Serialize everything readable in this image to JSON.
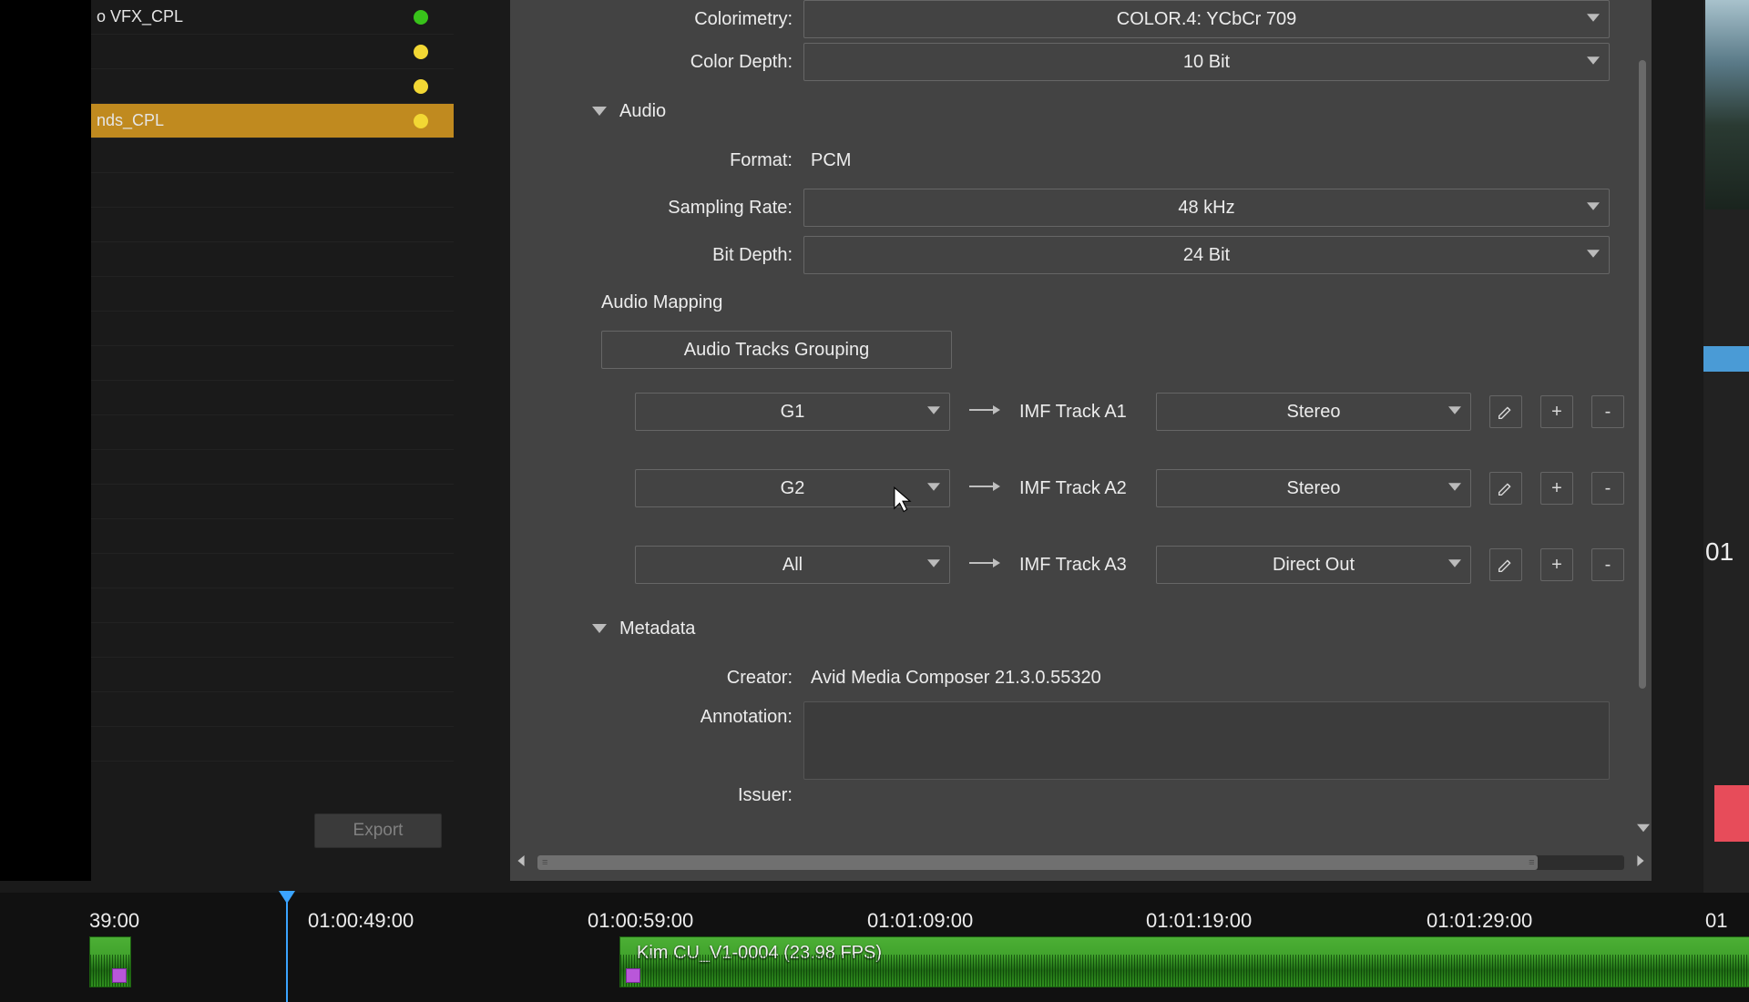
{
  "sidebar": {
    "items": [
      {
        "label": "o VFX_CPL",
        "dot": "green",
        "selected": false
      },
      {
        "label": "",
        "dot": "yellow",
        "selected": false
      },
      {
        "label": "",
        "dot": "yellow",
        "selected": false
      },
      {
        "label": "nds_CPL",
        "dot": "yellow",
        "selected": true
      }
    ],
    "export_label": "Export"
  },
  "settings": {
    "colorimetry": {
      "label": "Colorimetry:",
      "value": "COLOR.4: YCbCr 709"
    },
    "color_depth": {
      "label": "Color Depth:",
      "value": "10 Bit"
    },
    "audio_section": "Audio",
    "format": {
      "label": "Format:",
      "value": "PCM"
    },
    "sampling_rate": {
      "label": "Sampling Rate:",
      "value": "48 kHz"
    },
    "bit_depth": {
      "label": "Bit Depth:",
      "value": "24 Bit"
    },
    "audio_mapping_label": "Audio Mapping",
    "grouping_btn": "Audio Tracks Grouping",
    "tracks": [
      {
        "group": "G1",
        "track": "IMF Track A1",
        "mode": "Stereo"
      },
      {
        "group": "G2",
        "track": "IMF Track A2",
        "mode": "Stereo"
      },
      {
        "group": "All",
        "track": "IMF Track A3",
        "mode": "Direct Out"
      }
    ],
    "metadata_section": "Metadata",
    "creator": {
      "label": "Creator:",
      "value": "Avid Media Composer 21.3.0.55320"
    },
    "annotation": {
      "label": "Annotation:",
      "value": ""
    },
    "issuer": {
      "label": "Issuer:",
      "value": ""
    },
    "btn_plus": "+",
    "btn_minus": "-"
  },
  "right": {
    "tc": "01"
  },
  "timeline": {
    "ticks": [
      {
        "pos": 98,
        "label": "39:00"
      },
      {
        "pos": 338,
        "label": "01:00:49:00"
      },
      {
        "pos": 645,
        "label": "01:00:59:00"
      },
      {
        "pos": 952,
        "label": "01:01:09:00"
      },
      {
        "pos": 1258,
        "label": "01:01:19:00"
      },
      {
        "pos": 1566,
        "label": "01:01:29:00"
      },
      {
        "pos": 1872,
        "label": "01"
      }
    ],
    "clip_name": "Kim CU_V1-0004 (23.98 FPS)"
  }
}
